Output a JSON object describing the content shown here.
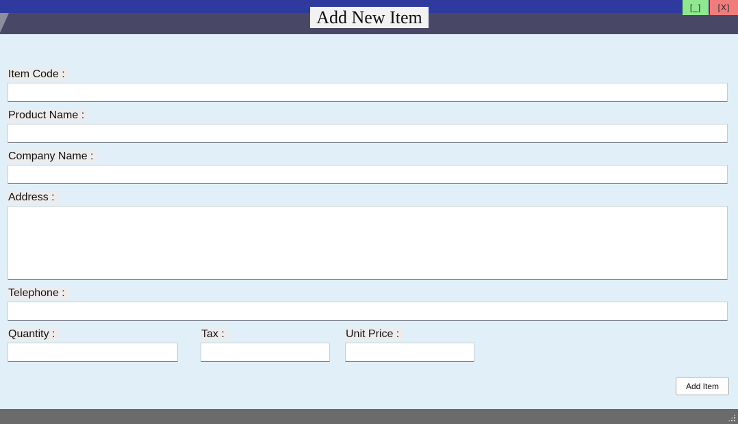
{
  "window": {
    "title": "Add New Item",
    "minimize_label": "[_]",
    "close_label": "[X]"
  },
  "form": {
    "item_code": {
      "label": "Item Code :",
      "value": ""
    },
    "product_name": {
      "label": "Product Name :",
      "value": ""
    },
    "company_name": {
      "label": "Company Name :",
      "value": ""
    },
    "address": {
      "label": "Address :",
      "value": ""
    },
    "telephone": {
      "label": "Telephone :",
      "value": ""
    },
    "quantity": {
      "label": "Quantity :",
      "value": ""
    },
    "tax": {
      "label": "Tax :",
      "value": ""
    },
    "unit_price": {
      "label": "Unit Price :",
      "value": ""
    },
    "submit_label": "Add Item"
  },
  "colors": {
    "titlebar": "#484866",
    "titlebar_stripe": "#2e3a9e",
    "background": "#e1eff8",
    "minimize": "#8fe88f",
    "close": "#ef7d7d",
    "statusbar": "#6b6b6b"
  }
}
